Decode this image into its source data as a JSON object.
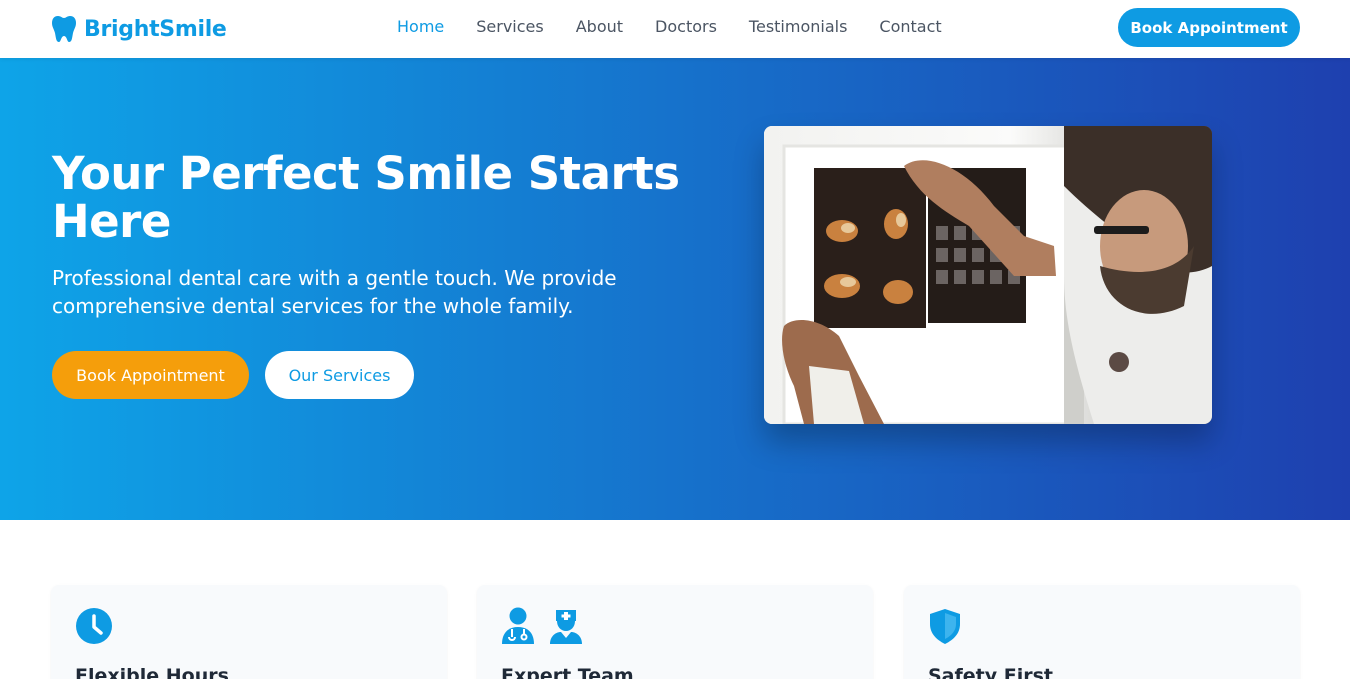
{
  "brand": {
    "name": "BrightSmile",
    "icon": "tooth-icon",
    "color": "#0e9be3"
  },
  "nav": {
    "links": [
      {
        "label": "Home",
        "active": true
      },
      {
        "label": "Services",
        "active": false
      },
      {
        "label": "About",
        "active": false
      },
      {
        "label": "Doctors",
        "active": false
      },
      {
        "label": "Testimonials",
        "active": false
      },
      {
        "label": "Contact",
        "active": false
      }
    ],
    "cta_label": "Book Appointment"
  },
  "hero": {
    "title": "Your Perfect Smile Starts Here",
    "subtitle": "Professional dental care with a gentle touch. We provide comprehensive dental services for the whole family.",
    "primary_button": "Book Appointment",
    "secondary_button": "Our Services",
    "gradient_start": "#0ea4e8",
    "gradient_end": "#1e40af",
    "accent_button_color": "#f59e0b"
  },
  "features": [
    {
      "title": "Flexible Hours",
      "icon": "clock-icon"
    },
    {
      "title": "Expert Team",
      "icon": "doctor-nurse-icon"
    },
    {
      "title": "Safety First",
      "icon": "shield-icon"
    }
  ]
}
